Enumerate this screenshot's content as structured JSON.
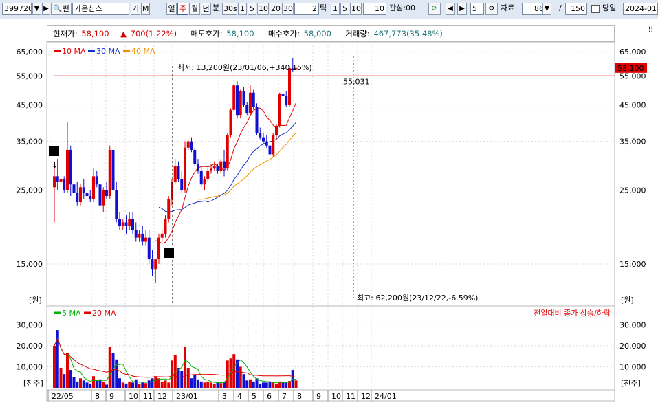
{
  "toolbar": {
    "code": "399720",
    "name_prefix": "펀",
    "stock_name": "가온칩스",
    "btn_gi": "기",
    "btn_m": "M",
    "periods": [
      "일",
      "주",
      "월",
      "년"
    ],
    "active_period": "주",
    "btn_bun": "분",
    "btn_30s": "30s",
    "ticks_a": [
      "1",
      "5",
      "10",
      "20",
      "30"
    ],
    "tick_value": "2",
    "tick_label": "틱",
    "ticks_b": [
      "1",
      "5",
      "10"
    ],
    "tick_b_value": "10",
    "interest_label": "관심:00",
    "step_value": "5",
    "data_label": "자료",
    "data_count": "86",
    "slash": "/",
    "total_count": "150",
    "today_label": "당일",
    "date_value": "2024-01-"
  },
  "info_bar": {
    "current_label": "현재가:",
    "current_value": "58,100",
    "change_arrow": "▲",
    "change_value": "700(1.22%)",
    "ask_label": "매도호가:",
    "ask_value": "58,100",
    "bid_label": "매수호가:",
    "bid_value": "58,000",
    "volume_label": "거래량:",
    "volume_value": "467,773(35.48%)"
  },
  "colors": {
    "up": "#e00000",
    "down": "#1010d0",
    "ma10": "#e00000",
    "ma30": "#1030d0",
    "ma40": "#f09000",
    "vol_ma5": "#00b000",
    "vol_ma20": "#e00000",
    "grid": "#d9d9d9"
  },
  "chart_data": {
    "type": "candlestick",
    "price_axis": {
      "ticks": [
        "65,000",
        "55,000",
        "45,000",
        "35,000",
        "25,000",
        "15,000"
      ],
      "unit_label": "[원]",
      "ylim": [
        11500,
        66000
      ],
      "scale": "log"
    },
    "volume_axis": {
      "ticks": [
        "30,000",
        "20,000",
        "10,000"
      ],
      "unit_label": "[천주]",
      "ylim": [
        0,
        38000
      ]
    },
    "x_labels": [
      "22/05",
      "8",
      "9",
      "10",
      "11",
      "12",
      "23/01",
      "3",
      "4",
      "5",
      "6",
      "7",
      "8",
      "9",
      "10",
      "11",
      "12",
      "24/01"
    ],
    "price_legend": [
      {
        "name": "10 MA",
        "color": "#e00000"
      },
      {
        "name": "30 MA",
        "color": "#1030d0"
      },
      {
        "name": "40 MA",
        "color": "#f09000"
      }
    ],
    "volume_legend": [
      {
        "name": "5 MA",
        "color": "#00b000"
      },
      {
        "name": "20 MA",
        "color": "#e00000"
      }
    ],
    "volume_note": "전일대비 종가 상승/하락",
    "current_price_tag": "58,100",
    "low_annotation": "최저: 13,200원(23/01/06,+340.15%)",
    "high_annotation": "최고: 62,200원(23/12/22,-6.59%)",
    "level_label": "55,031",
    "level_value": 55031,
    "new_listing_badge": "신",
    "event_badge": "매",
    "candles": [
      [
        25500,
        30500,
        20000,
        27500
      ],
      [
        27500,
        31000,
        25000,
        26500
      ],
      [
        26500,
        28000,
        25500,
        27000
      ],
      [
        27000,
        27500,
        24500,
        25000
      ],
      [
        25000,
        40000,
        24500,
        33000
      ],
      [
        33000,
        34000,
        24000,
        26000
      ],
      [
        26000,
        28000,
        24000,
        24500
      ],
      [
        24500,
        26500,
        22500,
        23000
      ],
      [
        23000,
        26000,
        22500,
        25500
      ],
      [
        25500,
        27000,
        23500,
        24500
      ],
      [
        24500,
        26000,
        23000,
        24000
      ],
      [
        24000,
        25000,
        23000,
        23500
      ],
      [
        23500,
        29000,
        23000,
        27500
      ],
      [
        27500,
        28500,
        25500,
        26000
      ],
      [
        26000,
        26500,
        22000,
        22500
      ],
      [
        22500,
        25500,
        21500,
        25000
      ],
      [
        25000,
        26500,
        23500,
        24000
      ],
      [
        24000,
        34000,
        23500,
        33000
      ],
      [
        33000,
        34500,
        22500,
        25000
      ],
      [
        25000,
        26500,
        20000,
        20500
      ],
      [
        20500,
        21500,
        19000,
        19500
      ],
      [
        19500,
        20500,
        19000,
        20000
      ],
      [
        20000,
        21000,
        18500,
        19500
      ],
      [
        19500,
        21500,
        19000,
        20500
      ],
      [
        20500,
        21500,
        18500,
        19000
      ],
      [
        19000,
        20000,
        17500,
        18000
      ],
      [
        18000,
        19000,
        17500,
        18500
      ],
      [
        18500,
        19500,
        17000,
        17500
      ],
      [
        17500,
        19000,
        17000,
        18000
      ],
      [
        18000,
        19000,
        15000,
        15500
      ],
      [
        15500,
        16500,
        13800,
        14500
      ],
      [
        14500,
        15000,
        13200,
        15500
      ],
      [
        15500,
        18500,
        15000,
        18000
      ],
      [
        18000,
        19000,
        17500,
        18500
      ],
      [
        18500,
        21000,
        18000,
        20500
      ],
      [
        20500,
        24000,
        20000,
        23500
      ],
      [
        23500,
        27000,
        22500,
        26500
      ],
      [
        26500,
        31000,
        26000,
        29500
      ],
      [
        29500,
        30500,
        26500,
        27000
      ],
      [
        27000,
        28500,
        24500,
        25000
      ],
      [
        25000,
        35000,
        24500,
        33500
      ],
      [
        33500,
        35500,
        33000,
        35000
      ],
      [
        35000,
        36000,
        32500,
        33000
      ],
      [
        33000,
        33500,
        29500,
        30000
      ],
      [
        30000,
        31000,
        28000,
        28500
      ],
      [
        28500,
        29500,
        25500,
        26000
      ],
      [
        26000,
        27500,
        25000,
        27000
      ],
      [
        27000,
        29000,
        26500,
        28500
      ],
      [
        28500,
        30000,
        28000,
        29000
      ],
      [
        29000,
        30500,
        28500,
        29500
      ],
      [
        29500,
        30000,
        28000,
        28500
      ],
      [
        28500,
        31000,
        28000,
        30500
      ],
      [
        30500,
        33000,
        27500,
        29000
      ],
      [
        29000,
        37000,
        28500,
        36500
      ],
      [
        36500,
        44000,
        36000,
        43500
      ],
      [
        43500,
        52000,
        43000,
        51500
      ],
      [
        51500,
        53000,
        41000,
        42000
      ],
      [
        42000,
        50000,
        41000,
        49500
      ],
      [
        49500,
        51000,
        44500,
        45000
      ],
      [
        45000,
        46000,
        42000,
        42500
      ],
      [
        42500,
        51500,
        42000,
        49000
      ],
      [
        49000,
        50000,
        43500,
        44500
      ],
      [
        44500,
        45500,
        36500,
        37000
      ],
      [
        37000,
        38500,
        35500,
        36000
      ],
      [
        36000,
        37000,
        34500,
        35000
      ],
      [
        35000,
        36500,
        33500,
        34000
      ],
      [
        34000,
        35000,
        31500,
        32000
      ],
      [
        32000,
        37000,
        31500,
        36500
      ],
      [
        36500,
        39500,
        35500,
        39000
      ],
      [
        39000,
        49000,
        38500,
        48500
      ],
      [
        48500,
        51000,
        47000,
        48000
      ],
      [
        48000,
        49500,
        44500,
        45000
      ],
      [
        45000,
        59000,
        44500,
        58000
      ],
      [
        58000,
        62200,
        56500,
        57400
      ],
      [
        57400,
        61000,
        56500,
        58100
      ]
    ],
    "volumes": [
      20000,
      27500,
      9500,
      6500,
      16500,
      8500,
      5000,
      3000,
      4500,
      3500,
      2500,
      2000,
      5500,
      3500,
      4000,
      3000,
      1500,
      19500,
      16500,
      13500,
      4500,
      2500,
      2000,
      3000,
      2500,
      4000,
      1800,
      2500,
      2200,
      3500,
      4500,
      5500,
      4500,
      3000,
      3500,
      2500,
      13000,
      15500,
      9500,
      8000,
      19500,
      9500,
      4500,
      6000,
      4000,
      3000,
      2500,
      3000,
      2500,
      2000,
      2500,
      2200,
      3000,
      13000,
      14000,
      16000,
      13500,
      10000,
      6500,
      3500,
      4000,
      3000,
      4500,
      2000,
      2500,
      2500,
      3000,
      2500,
      2000,
      3000,
      2500,
      2800,
      3200,
      8500,
      3500
    ]
  }
}
